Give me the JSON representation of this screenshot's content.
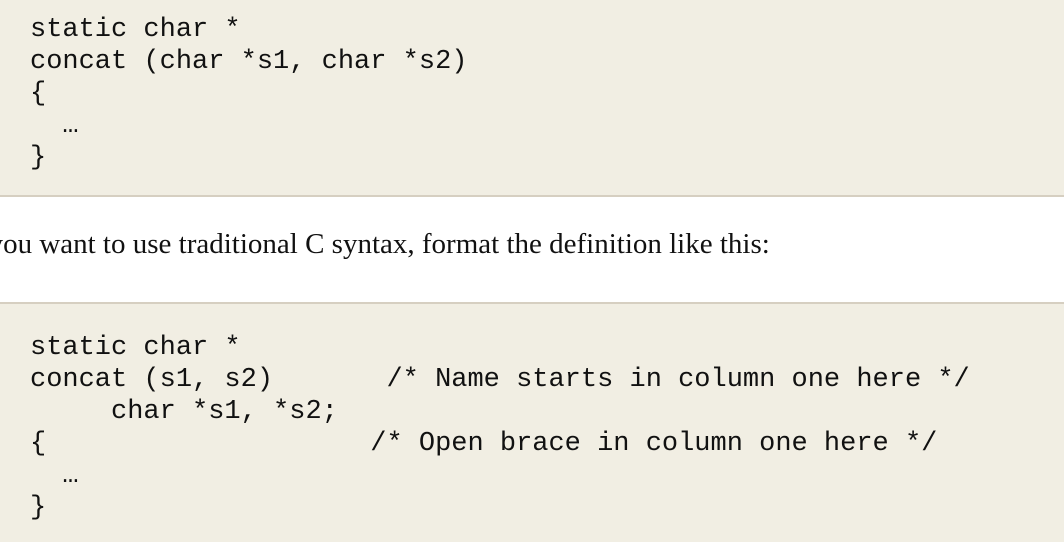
{
  "example_ansi": {
    "lines": [
      "static char *",
      "concat (char *s1, char *s2)",
      "{",
      "  …",
      "}"
    ]
  },
  "paragraph": "If you want to use traditional C syntax, format the definition like this:",
  "example_traditional": {
    "lines": [
      "static char *",
      "concat (s1, s2)       /* Name starts in column one here */",
      "     char *s1, *s2;",
      "{                    /* Open brace in column one here */",
      "  …",
      "}"
    ]
  }
}
